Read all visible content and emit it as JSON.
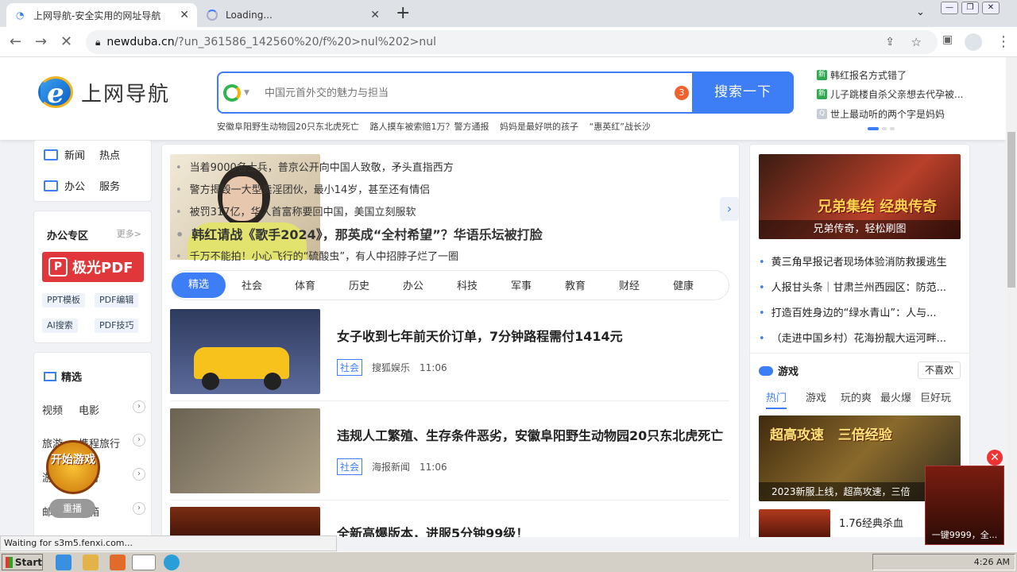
{
  "browser": {
    "tabs": [
      {
        "title": "上网导航-安全实用的网址导航",
        "close": "✕"
      },
      {
        "title": "Loading...",
        "close": "✕"
      }
    ],
    "new_tab": "+",
    "url_host": "newduba.cn",
    "url_path": "/?un_361586_142560%20/f%20>nul%202>nul",
    "status": "Waiting for s3m5.fenxi.com..."
  },
  "header": {
    "logo_text": "上网导航",
    "search_placeholder": "中国元首外交的魅力与担当",
    "search_badge": "3",
    "search_button": "搜索一下",
    "hot_links": [
      "安徽阜阳野生动物园20只东北虎死亡",
      "路人摸车被索赔1万？警方通报",
      "妈妈是最好哄的孩子",
      "“惠英红”战长沙"
    ],
    "right_hot": [
      {
        "icon": "新",
        "text": "韩红报名方式错了"
      },
      {
        "icon": "新",
        "text": "儿子跳楼自杀父亲想去代孕被..."
      },
      {
        "icon": "Q",
        "text": "世上最动听的两个字是妈妈"
      }
    ]
  },
  "left": {
    "quick": [
      [
        "新闻",
        "热点"
      ],
      [
        "办公",
        "服务"
      ]
    ],
    "office_title": "办公专区",
    "office_more": "更多>",
    "pdf_label": "极光PDF",
    "pdf_icon": "P",
    "office_tags": [
      "PPT模板",
      "PDF编辑",
      "AI搜索",
      "PDF技巧"
    ],
    "featured_title": "精选",
    "featured": [
      [
        "视频",
        "电影"
      ],
      [
        "旅游",
        "携程旅行"
      ],
      [
        "游戏",
        "传奇"
      ],
      [
        "邮箱",
        "邮箱"
      ]
    ],
    "game_float": "开始游戏",
    "replay": "重播"
  },
  "main": {
    "headlines": [
      "当着9000名士兵，普京公开向中国人致敬，矛头直指西方",
      "警方揭毁一大型卖淫团伙，最小14岁，甚至还有情侣",
      "被罚317亿，华人首富称要回中国，美国立刻服软",
      "韩红请战《歌手2024》，那英成“全村希望”？华语乐坛被打脸",
      "千万不能拍！小心飞行的“硫酸虫”，有人中招脖子烂了一圈"
    ],
    "categories": [
      "精选",
      "社会",
      "体育",
      "历史",
      "办公",
      "科技",
      "军事",
      "教育",
      "财经",
      "健康"
    ],
    "feed": [
      {
        "title": "女子收到七年前天价订单，7分钟路程需付1414元",
        "tag": "社会",
        "source": "搜狐娱乐",
        "time": "11:06"
      },
      {
        "title": "违规人工繁殖、生存条件恶劣，安徽阜阳野生动物园20只东北虎死亡",
        "tag": "社会",
        "source": "海报新闻",
        "time": "11:06"
      },
      {
        "title": "全新高爆版本，进服5分钟99级！"
      }
    ]
  },
  "right": {
    "banner_caption": "兄弟传奇，轻松刷图",
    "banner_text": "兄弟集结 经典传奇",
    "news": [
      "黄三角早报记者现场体验消防救援逃生",
      "人报甘头条｜甘肃兰州西园区：防范...",
      "打造百姓身边的“绿水青山”：人与...",
      "（走进中国乡村）花海扮靓大运河畔..."
    ],
    "game_title": "游戏",
    "dislike": "不喜欢",
    "game_tabs": [
      "热门",
      "游戏",
      "玩的爽",
      "最火爆",
      "巨好玩"
    ],
    "game_banner": "2023新服上线，超高攻速，三倍",
    "game_banner_title": "超高攻速   三倍经验",
    "game2": "1.76经典杀血",
    "ad_text": "一键9999，全..."
  },
  "taskbar": {
    "start": "Start",
    "clock": "4:26 AM"
  }
}
